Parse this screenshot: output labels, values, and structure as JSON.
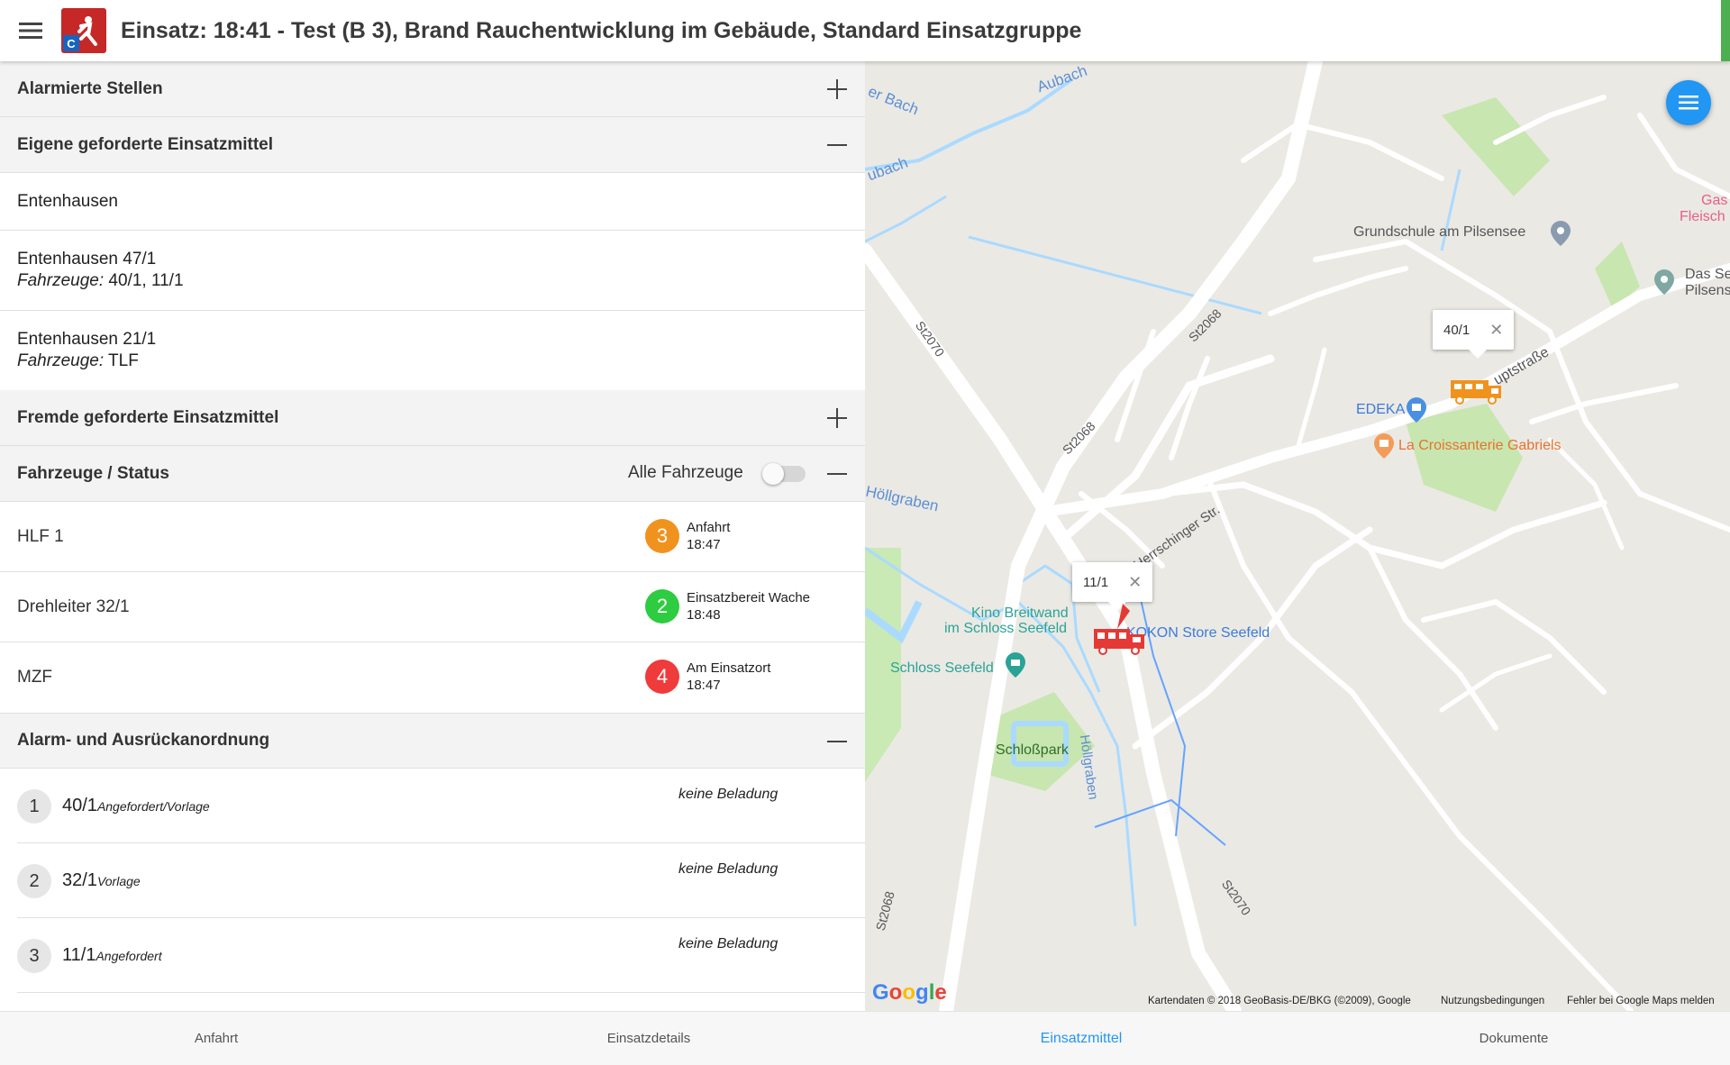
{
  "header": {
    "title": "Einsatz: 18:41 - Test (B 3), Brand Rauchentwicklung im Gebäude, Standard Einsatzgruppe"
  },
  "sections": {
    "alarmierte": "Alarmierte Stellen",
    "eigene": "Eigene geforderte Einsatzmittel",
    "fremde": "Fremde geforderte Einsatzmittel",
    "fahrzeuge": "Fahrzeuge / Status",
    "aao": "Alarm- und Ausrückanordnung"
  },
  "eigene_items": [
    {
      "name": "Entenhausen"
    },
    {
      "name": "Entenhausen 47/1",
      "label": "Fahrzeuge:",
      "value": " 40/1, 11/1"
    },
    {
      "name": "Entenhausen 21/1",
      "label": "Fahrzeuge:",
      "value": " TLF"
    }
  ],
  "fahrzeuge_toggle_label": "Alle Fahrzeuge",
  "vehicles": [
    {
      "name": "HLF 1",
      "status": "3",
      "status_text": "Anfahrt",
      "time": "18:47",
      "color": "#f0931e"
    },
    {
      "name": "Drehleiter 32/1",
      "status": "2",
      "status_text": "Einsatzbereit Wache",
      "time": "18:48",
      "color": "#2ecc40"
    },
    {
      "name": "MZF",
      "status": "4",
      "status_text": "Am Einsatzort",
      "time": "18:47",
      "color": "#ef3b3b"
    }
  ],
  "aao": [
    {
      "index": "1",
      "name": "40/1",
      "tag": "Angefordert/Vorlage",
      "beladung": "keine Beladung"
    },
    {
      "index": "2",
      "name": "32/1",
      "tag": "Vorlage",
      "beladung": "keine Beladung"
    },
    {
      "index": "3",
      "name": "11/1",
      "tag": "Angefordert",
      "beladung": "keine Beladung"
    }
  ],
  "map": {
    "popups": [
      "40/1",
      "11/1"
    ],
    "labels": {
      "aubach": "Aubach",
      "bach": "er Bach",
      "ubach": "ubach",
      "grundschule": "Grundschule am Pilsensee",
      "edeka": "EDEKA",
      "croissant": "La Croissanterie Gabriels",
      "kino1": "Kino Breitwand",
      "kino2": "im Schloss Seefeld",
      "kokon": "KOKON Store Seefeld",
      "schloss": "Schloss Seefeld",
      "schlosspark": "Schloßpark",
      "hoellgraben": "Höllgraben",
      "hoellgraben2": "Höllgraben",
      "hauptstrasse": "uptstraße",
      "herrschinger": "Herrschinger Str.",
      "st2068a": "St2068",
      "st2068b": "St2068",
      "st2068c": "St2068",
      "st2070a": "St2070",
      "st2070b": "St2070",
      "gas": "Gas",
      "fleisch": "Fleisch",
      "das": "Das Se",
      "pilsens": "Pilsens"
    },
    "google": "Google",
    "attribution": "Kartendaten © 2018 GeoBasis-DE/BKG (©2009), Google",
    "terms": "Nutzungsbedingungen",
    "report": "Fehler bei Google Maps melden"
  },
  "tabs": [
    "Anfahrt",
    "Einsatzdetails",
    "Einsatzmittel",
    "Dokumente"
  ],
  "active_tab": "Einsatzmittel"
}
